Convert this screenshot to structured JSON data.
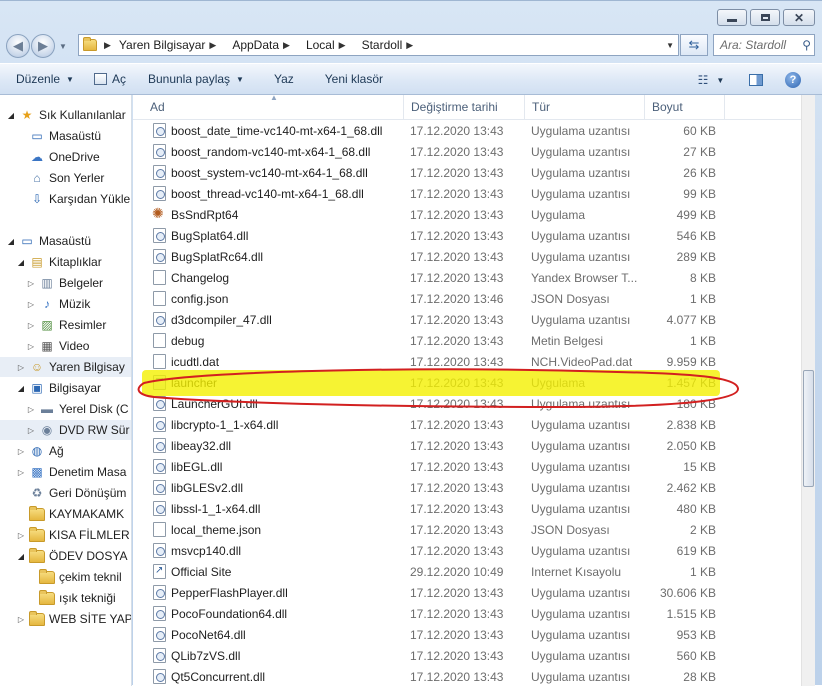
{
  "address": {
    "crumbs": [
      "Yaren Bilgisayar",
      "AppData",
      "Local",
      "Stardoll"
    ]
  },
  "search": {
    "placeholder": "Ara: Stardoll"
  },
  "toolbar": {
    "organize": "Düzenle",
    "open": "Aç",
    "share": "Bununla paylaş",
    "burn": "Yaz",
    "new_folder": "Yeni klasör"
  },
  "nav_tree": [
    {
      "label": "Sık Kullanılanlar",
      "icon": "star-icon"
    },
    {
      "label": "Masaüstü",
      "icon": "desktop-icon"
    },
    {
      "label": "OneDrive",
      "icon": "onedrive-icon"
    },
    {
      "label": "Son Yerler",
      "icon": "recent-places-icon"
    },
    {
      "label": "Karşıdan Yükle",
      "icon": "downloads-icon"
    },
    {
      "label": "Masaüstü",
      "icon": "desktop-icon"
    },
    {
      "label": "Kitaplıklar",
      "icon": "libraries-icon"
    },
    {
      "label": "Belgeler",
      "icon": "documents-icon"
    },
    {
      "label": "Müzik",
      "icon": "music-icon"
    },
    {
      "label": "Resimler",
      "icon": "pictures-icon"
    },
    {
      "label": "Video",
      "icon": "video-icon"
    },
    {
      "label": "Yaren Bilgisay",
      "icon": "user-icon"
    },
    {
      "label": "Bilgisayar",
      "icon": "computer-icon"
    },
    {
      "label": "Yerel Disk (C",
      "icon": "disk-icon"
    },
    {
      "label": "DVD RW Sür",
      "icon": "dvd-icon"
    },
    {
      "label": "Ağ",
      "icon": "network-icon"
    },
    {
      "label": "Denetim Masa",
      "icon": "control-panel-icon"
    },
    {
      "label": "Geri Dönüşüm",
      "icon": "recycle-bin-icon"
    },
    {
      "label": "KAYMAKAMK",
      "icon": "folder-icon"
    },
    {
      "label": "KISA FİLMLER",
      "icon": "folder-icon"
    },
    {
      "label": "ÖDEV DOSYA",
      "icon": "folder-icon"
    },
    {
      "label": "çekim teknil",
      "icon": "folder-icon"
    },
    {
      "label": "ışık tekniği",
      "icon": "folder-icon"
    },
    {
      "label": "WEB SİTE YAP",
      "icon": "folder-icon"
    }
  ],
  "columns": {
    "name": "Ad",
    "date": "Değiştirme tarihi",
    "type": "Tür",
    "size": "Boyut"
  },
  "files": [
    {
      "name": "boost_date_time-vc140-mt-x64-1_68.dll",
      "date": "17.12.2020 13:43",
      "type": "Uygulama uzantısı",
      "size": "60 KB",
      "icon": "dll"
    },
    {
      "name": "boost_random-vc140-mt-x64-1_68.dll",
      "date": "17.12.2020 13:43",
      "type": "Uygulama uzantısı",
      "size": "27 KB",
      "icon": "dll"
    },
    {
      "name": "boost_system-vc140-mt-x64-1_68.dll",
      "date": "17.12.2020 13:43",
      "type": "Uygulama uzantısı",
      "size": "26 KB",
      "icon": "dll"
    },
    {
      "name": "boost_thread-vc140-mt-x64-1_68.dll",
      "date": "17.12.2020 13:43",
      "type": "Uygulama uzantısı",
      "size": "99 KB",
      "icon": "dll"
    },
    {
      "name": "BsSndRpt64",
      "date": "17.12.2020 13:43",
      "type": "Uygulama",
      "size": "499 KB",
      "icon": "bug"
    },
    {
      "name": "BugSplat64.dll",
      "date": "17.12.2020 13:43",
      "type": "Uygulama uzantısı",
      "size": "546 KB",
      "icon": "dll"
    },
    {
      "name": "BugSplatRc64.dll",
      "date": "17.12.2020 13:43",
      "type": "Uygulama uzantısı",
      "size": "289 KB",
      "icon": "dll"
    },
    {
      "name": "Changelog",
      "date": "17.12.2020 13:43",
      "type": "Yandex Browser T...",
      "size": "8 KB",
      "icon": "doc"
    },
    {
      "name": "config.json",
      "date": "17.12.2020 13:46",
      "type": "JSON Dosyası",
      "size": "1 KB",
      "icon": "doc"
    },
    {
      "name": "d3dcompiler_47.dll",
      "date": "17.12.2020 13:43",
      "type": "Uygulama uzantısı",
      "size": "4.077 KB",
      "icon": "dll"
    },
    {
      "name": "debug",
      "date": "17.12.2020 13:43",
      "type": "Metin Belgesi",
      "size": "1 KB",
      "icon": "doc"
    },
    {
      "name": "icudtl.dat",
      "date": "17.12.2020 13:43",
      "type": "NCH.VideoPad.dat",
      "size": "9.959 KB",
      "icon": "doc"
    },
    {
      "name": "launcher",
      "date": "17.12.2020 13:43",
      "type": "Uygulama",
      "size": "1.457 KB",
      "icon": "exe"
    },
    {
      "name": "LauncherGUI.dll",
      "date": "17.12.2020 13:43",
      "type": "Uygulama uzantısı",
      "size": "180 KB",
      "icon": "dll"
    },
    {
      "name": "libcrypto-1_1-x64.dll",
      "date": "17.12.2020 13:43",
      "type": "Uygulama uzantısı",
      "size": "2.838 KB",
      "icon": "dll"
    },
    {
      "name": "libeay32.dll",
      "date": "17.12.2020 13:43",
      "type": "Uygulama uzantısı",
      "size": "2.050 KB",
      "icon": "dll"
    },
    {
      "name": "libEGL.dll",
      "date": "17.12.2020 13:43",
      "type": "Uygulama uzantısı",
      "size": "15 KB",
      "icon": "dll"
    },
    {
      "name": "libGLESv2.dll",
      "date": "17.12.2020 13:43",
      "type": "Uygulama uzantısı",
      "size": "2.462 KB",
      "icon": "dll"
    },
    {
      "name": "libssl-1_1-x64.dll",
      "date": "17.12.2020 13:43",
      "type": "Uygulama uzantısı",
      "size": "480 KB",
      "icon": "dll"
    },
    {
      "name": "local_theme.json",
      "date": "17.12.2020 13:43",
      "type": "JSON Dosyası",
      "size": "2 KB",
      "icon": "doc"
    },
    {
      "name": "msvcp140.dll",
      "date": "17.12.2020 13:43",
      "type": "Uygulama uzantısı",
      "size": "619 KB",
      "icon": "dll"
    },
    {
      "name": "Official Site",
      "date": "29.12.2020 10:49",
      "type": "Internet Kısayolu",
      "size": "1 KB",
      "icon": "lnk"
    },
    {
      "name": "PepperFlashPlayer.dll",
      "date": "17.12.2020 13:43",
      "type": "Uygulama uzantısı",
      "size": "30.606 KB",
      "icon": "dll"
    },
    {
      "name": "PocoFoundation64.dll",
      "date": "17.12.2020 13:43",
      "type": "Uygulama uzantısı",
      "size": "1.515 KB",
      "icon": "dll"
    },
    {
      "name": "PocoNet64.dll",
      "date": "17.12.2020 13:43",
      "type": "Uygulama uzantısı",
      "size": "953 KB",
      "icon": "dll"
    },
    {
      "name": "QLib7zVS.dll",
      "date": "17.12.2020 13:43",
      "type": "Uygulama uzantısı",
      "size": "560 KB",
      "icon": "dll"
    },
    {
      "name": "Qt5Concurrent.dll",
      "date": "17.12.2020 13:43",
      "type": "Uygulama uzantısı",
      "size": "28 KB",
      "icon": "dll"
    }
  ],
  "annotation": {
    "highlight_color": "#f4f000",
    "circle_color": "#d22020",
    "highlighted_file": "launcher"
  },
  "colors": {
    "toolbar_text": "#1e3956",
    "column_header_text": "#4c607a",
    "secondary_text": "#6d6d6d"
  }
}
